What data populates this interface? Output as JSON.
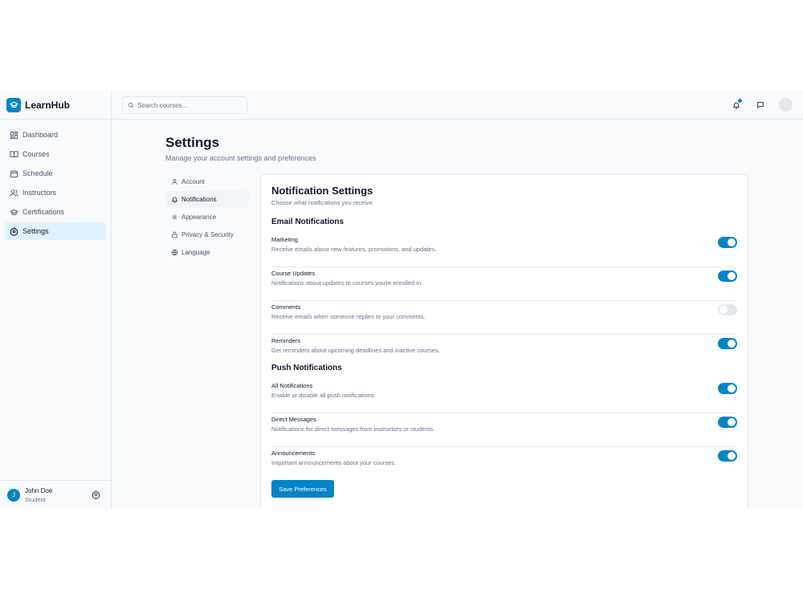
{
  "brand": {
    "name": "LearnHub"
  },
  "sidebar": {
    "items": [
      {
        "label": "Dashboard",
        "icon": "dashboard-icon"
      },
      {
        "label": "Courses",
        "icon": "book-icon"
      },
      {
        "label": "Schedule",
        "icon": "calendar-icon"
      },
      {
        "label": "Instructors",
        "icon": "users-icon"
      },
      {
        "label": "Certifications",
        "icon": "graduation-cap-icon"
      },
      {
        "label": "Settings",
        "icon": "gear-icon",
        "active": true
      }
    ]
  },
  "user": {
    "initial": "J",
    "name": "John Doe",
    "role": "Student"
  },
  "search": {
    "placeholder": "Search courses..."
  },
  "page": {
    "title": "Settings",
    "subtitle": "Manage your account settings and preferences"
  },
  "settings_nav": [
    {
      "label": "Account",
      "icon": "user-icon"
    },
    {
      "label": "Notifications",
      "icon": "bell-icon",
      "active": true
    },
    {
      "label": "Appearance",
      "icon": "sun-icon"
    },
    {
      "label": "Privacy & Security",
      "icon": "lock-icon"
    },
    {
      "label": "Language",
      "icon": "globe-icon"
    }
  ],
  "notifications": {
    "title": "Notification Settings",
    "subtitle": "Choose what notifications you receive",
    "email": {
      "title": "Email Notifications",
      "items": [
        {
          "title": "Marketing",
          "desc": "Receive emails about new features, promotions, and updates.",
          "enabled": true
        },
        {
          "title": "Course Updates",
          "desc": "Notifications about updates to courses you're enrolled in.",
          "enabled": true
        },
        {
          "title": "Comments",
          "desc": "Receive emails when someone replies to your comments.",
          "enabled": false
        },
        {
          "title": "Reminders",
          "desc": "Get reminders about upcoming deadlines and inactive courses.",
          "enabled": true
        }
      ]
    },
    "push": {
      "title": "Push Notifications",
      "items": [
        {
          "title": "All Notifications",
          "desc": "Enable or disable all push notifications.",
          "enabled": true
        },
        {
          "title": "Direct Messages",
          "desc": "Notifications for direct messages from instructors or students.",
          "enabled": true
        },
        {
          "title": "Announcements",
          "desc": "Important announcements about your courses.",
          "enabled": true
        }
      ]
    },
    "save_label": "Save Preferences"
  },
  "colors": {
    "accent": "#0284c7",
    "active_nav_bg": "#e0f2fe",
    "toggle_off": "#e2e8f0"
  }
}
